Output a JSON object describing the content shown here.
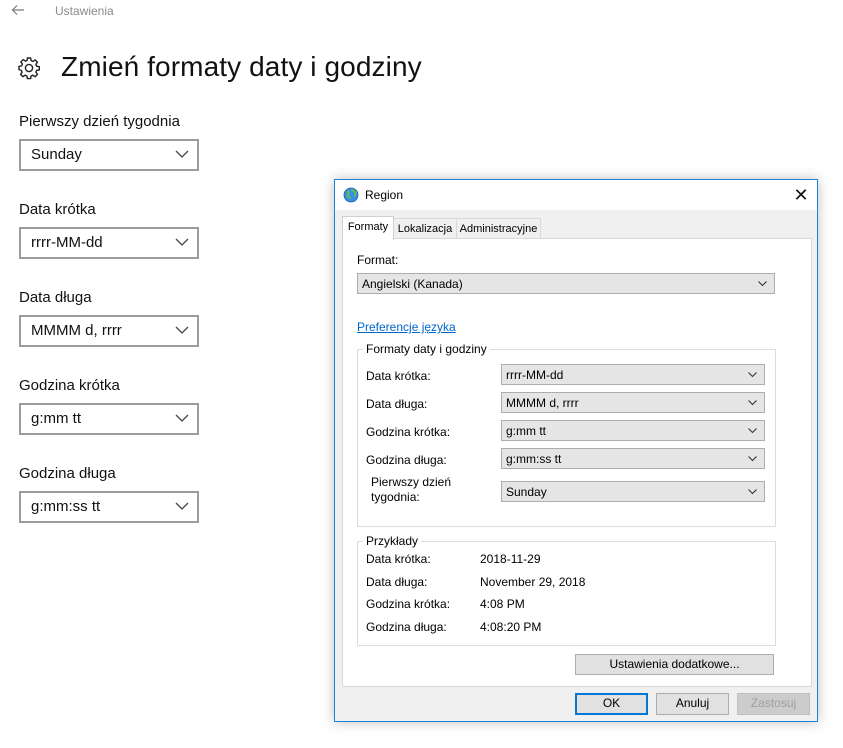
{
  "settings": {
    "breadcrumb": "Ustawienia",
    "title": "Zmień formaty daty i godziny",
    "fields": [
      {
        "label": "Pierwszy dzień tygodnia",
        "value": "Sunday"
      },
      {
        "label": "Data krótka",
        "value": "rrrr-MM-dd"
      },
      {
        "label": "Data długa",
        "value": "MMMM d, rrrr"
      },
      {
        "label": "Godzina krótka",
        "value": "g:mm tt"
      },
      {
        "label": "Godzina długa",
        "value": "g:mm:ss tt"
      }
    ]
  },
  "dialog": {
    "title": "Region",
    "tabs": [
      "Formaty",
      "Lokalizacja",
      "Administracyjne"
    ],
    "format_label": "Format:",
    "format_value": "Angielski (Kanada)",
    "language_link": "Preferencje języka",
    "formats_group": {
      "title": "Formaty daty i godziny",
      "rows": [
        {
          "label": "Data krótka:",
          "value": "rrrr-MM-dd"
        },
        {
          "label": "Data długa:",
          "value": "MMMM d, rrrr"
        },
        {
          "label": "Godzina krótka:",
          "value": "g:mm tt"
        },
        {
          "label": "Godzina długa:",
          "value": "g:mm:ss tt"
        }
      ],
      "first_day_label_1": "Pierwszy dzień",
      "first_day_label_2": "tygodnia:",
      "first_day_value": "Sunday"
    },
    "examples_group": {
      "title": "Przykłady",
      "rows": [
        {
          "label": "Data krótka:",
          "value": "2018-11-29"
        },
        {
          "label": "Data długa:",
          "value": "November 29, 2018"
        },
        {
          "label": "Godzina krótka:",
          "value": "4:08 PM"
        },
        {
          "label": "Godzina długa:",
          "value": "4:08:20 PM"
        }
      ]
    },
    "additional_button": "Ustawienia dodatkowe...",
    "ok_button": "OK",
    "cancel_button": "Anuluj",
    "apply_button": "Zastosuj"
  }
}
